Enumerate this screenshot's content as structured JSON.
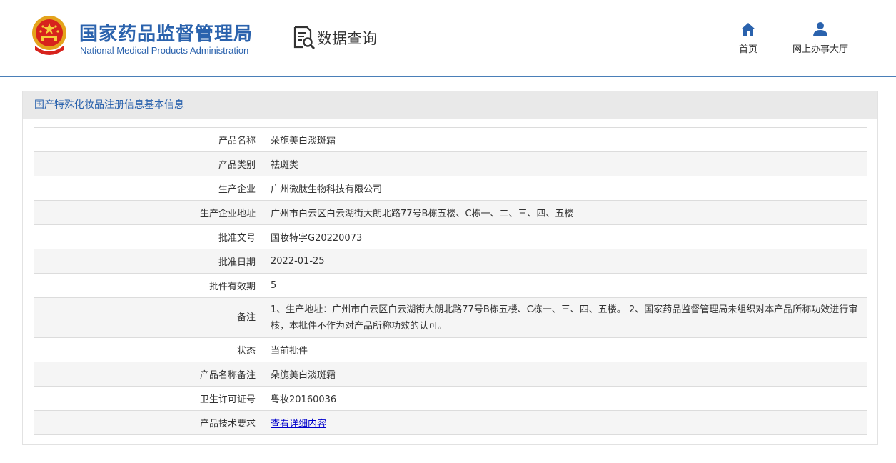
{
  "header": {
    "agency_cn": "国家药品监督管理局",
    "agency_en": "National Medical Products Administration",
    "section_title": "数据查询",
    "brand_color": "#2a62ad",
    "nav": [
      {
        "label": "首页",
        "icon": "home-icon"
      },
      {
        "label": "网上办事大厅",
        "icon": "user-icon"
      }
    ]
  },
  "panel": {
    "title": "国产特殊化妆品注册信息基本信息",
    "rows": [
      {
        "label": "产品名称",
        "value": "朵旎美白淡斑霜"
      },
      {
        "label": "产品类别",
        "value": "祛斑类"
      },
      {
        "label": "生产企业",
        "value": "广州微肽生物科技有限公司"
      },
      {
        "label": "生产企业地址",
        "value": "广州市白云区白云湖街大朗北路77号B栋五楼、C栋一、二、三、四、五楼"
      },
      {
        "label": "批准文号",
        "value": "国妆特字G20220073"
      },
      {
        "label": "批准日期",
        "value": "2022-01-25"
      },
      {
        "label": "批件有效期",
        "value": "5"
      },
      {
        "label": "备注",
        "value": "1、生产地址：广州市白云区白云湖街大朗北路77号B栋五楼、C栋一、三、四、五楼。 2、国家药品监督管理局未组织对本产品所称功效进行审核，本批件不作为对产品所称功效的认可。"
      },
      {
        "label": "状态",
        "value": "当前批件"
      },
      {
        "label": "产品名称备注",
        "value": "朵旎美白淡斑霜"
      },
      {
        "label": "卫生许可证号",
        "value": "粤妆20160036"
      },
      {
        "label": "产品技术要求",
        "value": "查看详细内容"
      }
    ]
  }
}
